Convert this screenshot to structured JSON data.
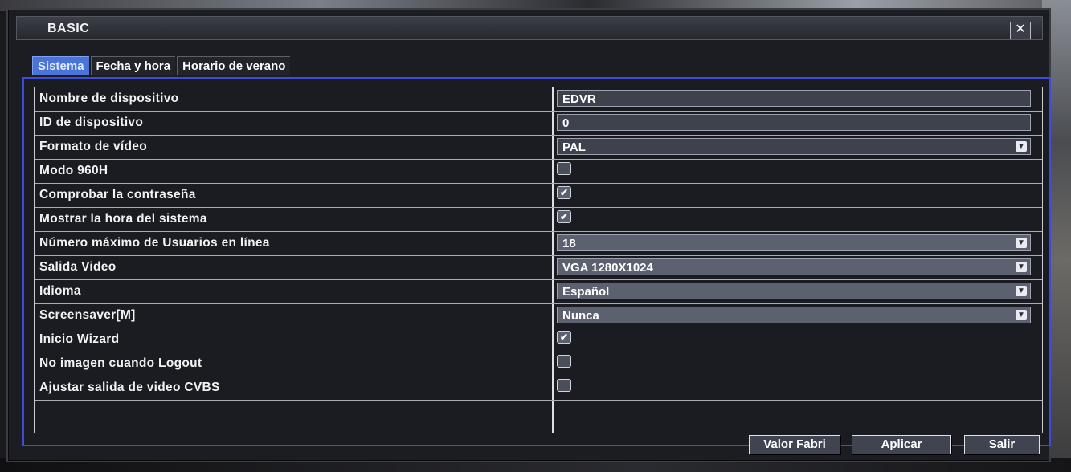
{
  "window": {
    "title": "BASIC",
    "close_glyph": "✕"
  },
  "tabs": [
    {
      "label": "Sistema",
      "active": true
    },
    {
      "label": "Fecha y hora",
      "active": false
    },
    {
      "label": "Horario de verano",
      "active": false
    }
  ],
  "settings": {
    "device_name": {
      "label": "Nombre de dispositivo",
      "value": "EDVR"
    },
    "device_id": {
      "label": "ID de dispositivo",
      "value": "0"
    },
    "video_format": {
      "label": "Formato de vídeo",
      "value": "PAL"
    },
    "mode_960h": {
      "label": "Modo 960H",
      "checked": false
    },
    "check_password": {
      "label": "Comprobar la contraseña",
      "checked": true
    },
    "show_system_time": {
      "label": "Mostrar la hora del sistema",
      "checked": true
    },
    "max_online_users": {
      "label": "Número máximo de Usuarios en línea",
      "value": "18"
    },
    "video_output": {
      "label": "Salida Video",
      "value": "VGA 1280X1024"
    },
    "language": {
      "label": "Idioma",
      "value": "Español"
    },
    "screensaver": {
      "label": "Screensaver[M]",
      "value": "Nunca"
    },
    "start_wizard": {
      "label": "Inicio Wizard",
      "checked": true
    },
    "no_image_logout": {
      "label": "No imagen cuando Logout",
      "checked": false
    },
    "adjust_cvbs": {
      "label": "Ajustar salida de video CVBS",
      "checked": false
    }
  },
  "buttons": {
    "default": "Valor Fabri",
    "apply": "Aplicar",
    "exit": "Salir"
  },
  "icons": {
    "check": "✔",
    "dropdown": "▼"
  },
  "colors": {
    "active_tab": "#4a74d8",
    "panel_border": "#3e4bd8"
  }
}
